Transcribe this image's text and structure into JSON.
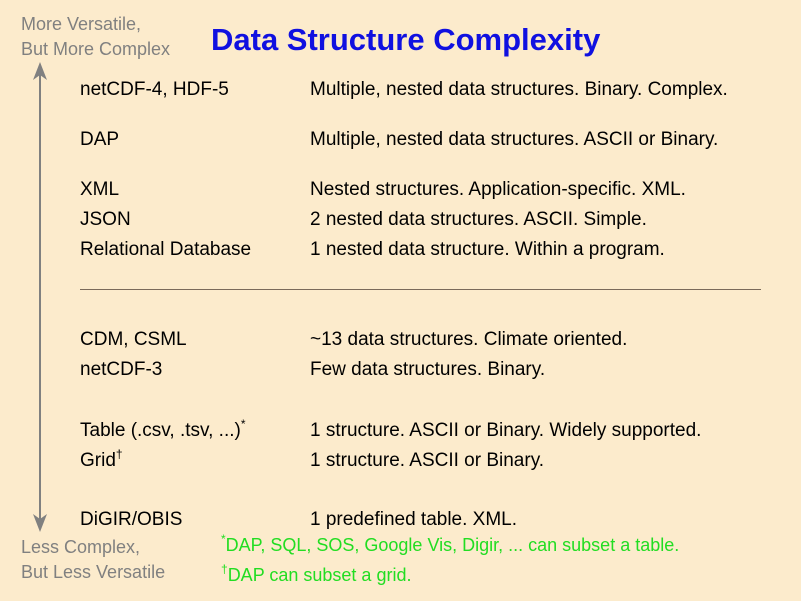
{
  "title": "Data Structure Complexity",
  "top_label": {
    "line1": "More Versatile,",
    "line2": "But More Complex"
  },
  "bottom_label": {
    "line1": "Less Complex,",
    "line2": "But Less Versatile"
  },
  "rows": [
    {
      "format": "netCDF-4, HDF-5",
      "description": "Multiple, nested data structures. Binary. Complex."
    },
    {
      "format": "DAP",
      "description": "Multiple, nested data structures. ASCII or Binary."
    },
    {
      "format": "XML",
      "description": "Nested structures. Application-specific. XML."
    },
    {
      "format": "JSON",
      "description": "2 nested data structures. ASCII. Simple."
    },
    {
      "format": "Relational Database",
      "description": "1 nested data structure. Within a program."
    },
    {
      "format": "CDM, CSML",
      "description": "~13 data structures. Climate oriented."
    },
    {
      "format": "netCDF-3",
      "description": "Few data structures. Binary."
    },
    {
      "format": "Table (.csv, .tsv, ...)",
      "marker": "*",
      "description": "1 structure. ASCII or Binary. Widely supported."
    },
    {
      "format": "Grid",
      "marker": "†",
      "description": "1 structure. ASCII or Binary."
    },
    {
      "format": "DiGIR/OBIS",
      "description": "1 predefined table. XML."
    }
  ],
  "footnotes": [
    {
      "marker": "*",
      "text": "DAP, SQL, SOS, Google Vis, Digir, ... can subset a table."
    },
    {
      "marker": "†",
      "text": "DAP can subset a grid."
    }
  ],
  "colors": {
    "background": "#fcebcc",
    "title": "#1010e0",
    "axis_labels": "#808080",
    "footnotes": "#22dd22",
    "arrow": "#808080"
  }
}
